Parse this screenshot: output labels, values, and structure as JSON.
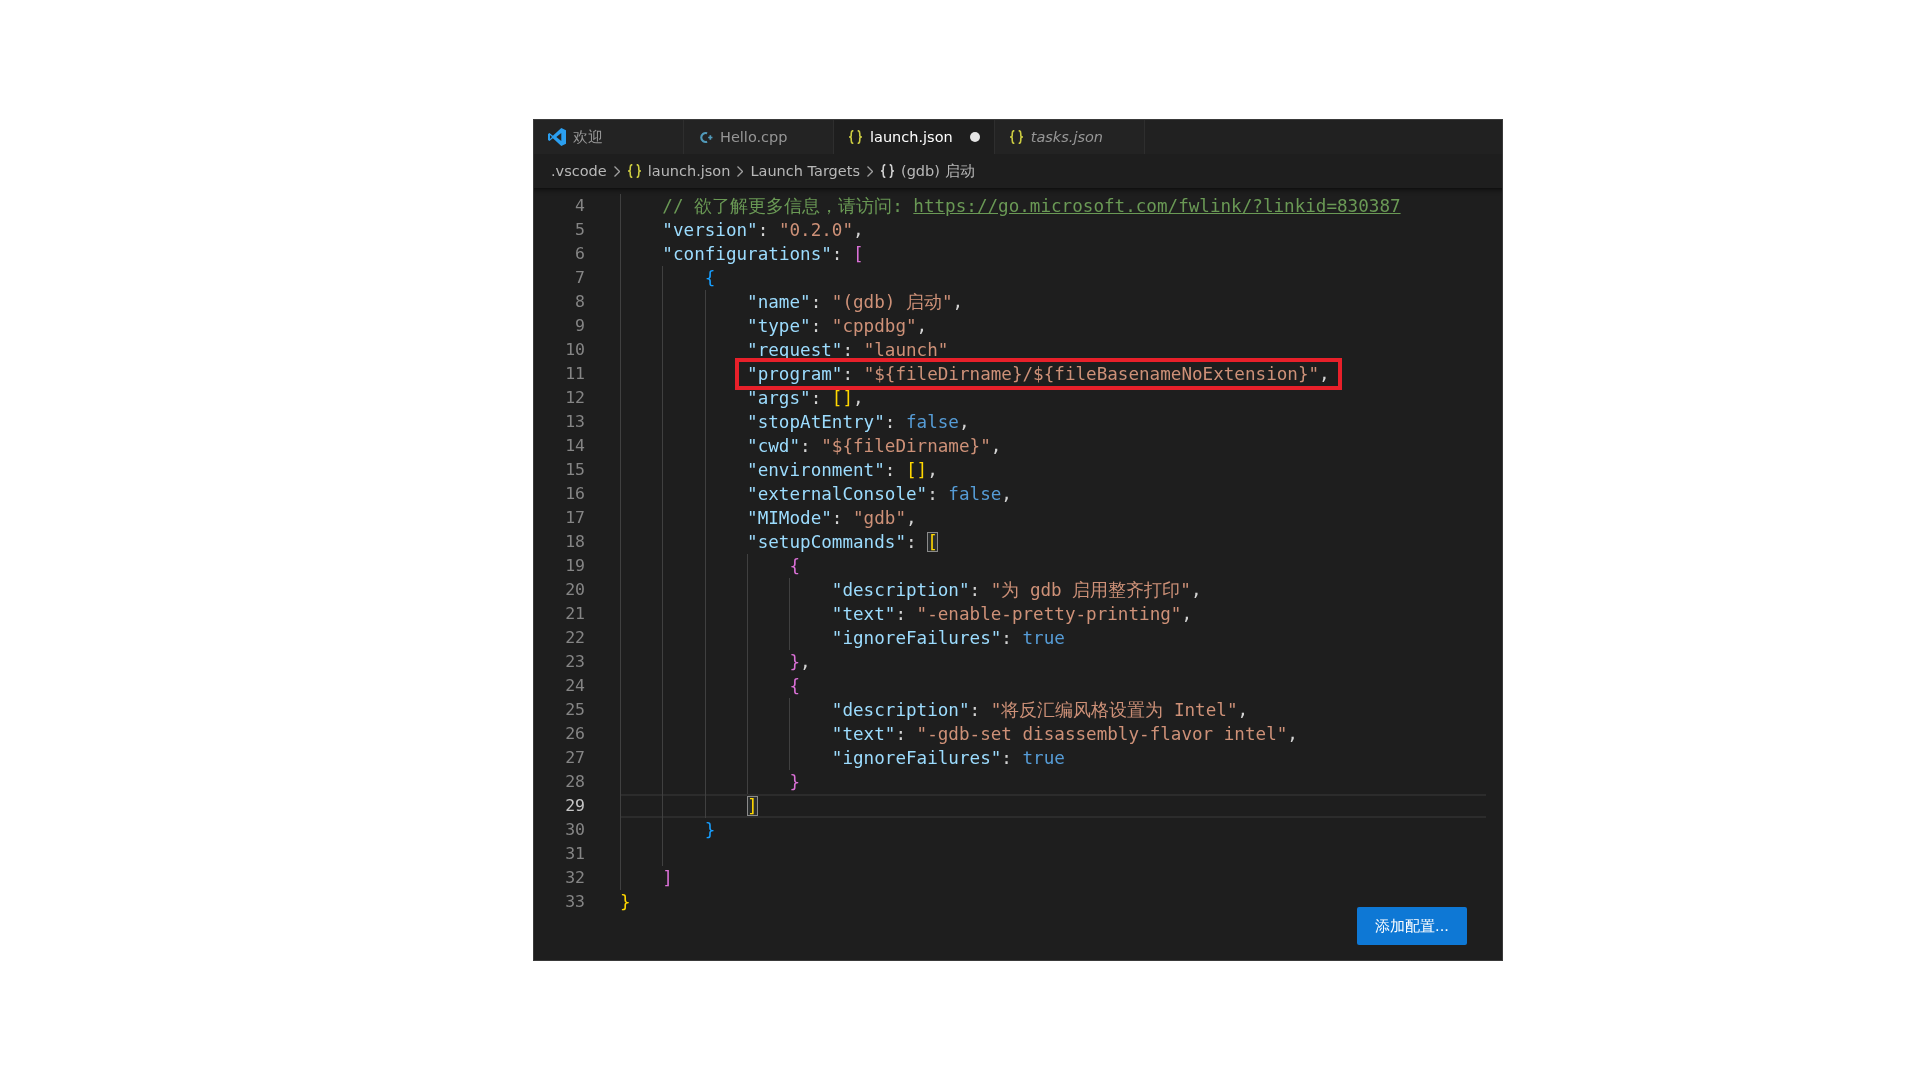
{
  "tabs": [
    {
      "label": "欢迎",
      "kind": "welcome",
      "selected": false,
      "modified": false,
      "preview": false
    },
    {
      "label": "Hello.cpp",
      "kind": "cpp",
      "selected": false,
      "modified": false,
      "preview": false
    },
    {
      "label": "launch.json",
      "kind": "json",
      "selected": true,
      "modified": true,
      "preview": false
    },
    {
      "label": "tasks.json",
      "kind": "json",
      "selected": false,
      "modified": false,
      "preview": true
    }
  ],
  "breadcrumbs": [
    {
      "label": ".vscode",
      "kind": "folder"
    },
    {
      "label": "launch.json",
      "kind": "json"
    },
    {
      "label": "Launch Targets",
      "kind": "section"
    },
    {
      "label": "(gdb) 启动",
      "kind": "object"
    }
  ],
  "editor": {
    "lines": [
      {
        "children": [
          {
            "number": "4",
            "current": false,
            "boxed": false,
            "tokens": [
              {
                "kind": "comment",
                "text": "// 欲了解更多信息，请访问: "
              },
              {
                "kind": "link",
                "text": "https://go.microsoft.com/fwlink/?linkid=830387"
              }
            ]
          },
          {
            "number": "5",
            "current": false,
            "boxed": false,
            "tokens": [
              {
                "kind": "key",
                "text": "\"version\""
              },
              {
                "kind": "punct",
                "text": ": "
              },
              {
                "kind": "string",
                "text": "\"0.2.0\""
              },
              {
                "kind": "punct",
                "text": ","
              }
            ]
          },
          {
            "number": "6",
            "current": false,
            "boxed": false,
            "tokens": [
              {
                "kind": "key",
                "text": "\"configurations\""
              },
              {
                "kind": "punct",
                "text": ": "
              },
              {
                "kind": "bracket",
                "text": "[",
                "color": "#da70d6",
                "matched": false
              }
            ],
            "children": [
              {
                "number": "7",
                "current": false,
                "boxed": false,
                "tokens": [
                  {
                    "kind": "bracket",
                    "text": "{",
                    "color": "#179fff",
                    "matched": false
                  }
                ],
                "children": [
                  {
                    "number": "8",
                    "current": false,
                    "boxed": false,
                    "tokens": [
                      {
                        "kind": "key",
                        "text": "\"name\""
                      },
                      {
                        "kind": "punct",
                        "text": ": "
                      },
                      {
                        "kind": "string",
                        "text": "\"(gdb) 启动\""
                      },
                      {
                        "kind": "punct",
                        "text": ","
                      }
                    ]
                  },
                  {
                    "number": "9",
                    "current": false,
                    "boxed": false,
                    "tokens": [
                      {
                        "kind": "key",
                        "text": "\"type\""
                      },
                      {
                        "kind": "punct",
                        "text": ": "
                      },
                      {
                        "kind": "string",
                        "text": "\"cppdbg\""
                      },
                      {
                        "kind": "punct",
                        "text": ","
                      }
                    ]
                  },
                  {
                    "number": "10",
                    "current": false,
                    "boxed": false,
                    "tokens": [
                      {
                        "kind": "key",
                        "text": "\"request\""
                      },
                      {
                        "kind": "punct",
                        "text": ": "
                      },
                      {
                        "kind": "string",
                        "text": "\"launch\""
                      }
                    ]
                  },
                  {
                    "number": "11",
                    "current": false,
                    "boxed": true,
                    "tokens": [
                      {
                        "kind": "key",
                        "text": "\"program\""
                      },
                      {
                        "kind": "punct",
                        "text": ": "
                      },
                      {
                        "kind": "string",
                        "text": "\"${fileDirname}/${fileBasenameNoExtension}\""
                      },
                      {
                        "kind": "punct",
                        "text": ","
                      }
                    ]
                  },
                  {
                    "number": "12",
                    "current": false,
                    "boxed": false,
                    "tokens": [
                      {
                        "kind": "key",
                        "text": "\"args\""
                      },
                      {
                        "kind": "punct",
                        "text": ": "
                      },
                      {
                        "kind": "bracket",
                        "text": "[]",
                        "color": "#ffd700",
                        "matched": false
                      },
                      {
                        "kind": "punct",
                        "text": ","
                      }
                    ]
                  },
                  {
                    "number": "13",
                    "current": false,
                    "boxed": false,
                    "tokens": [
                      {
                        "kind": "key",
                        "text": "\"stopAtEntry\""
                      },
                      {
                        "kind": "punct",
                        "text": ": "
                      },
                      {
                        "kind": "literal",
                        "text": "false"
                      },
                      {
                        "kind": "punct",
                        "text": ","
                      }
                    ]
                  },
                  {
                    "number": "14",
                    "current": false,
                    "boxed": false,
                    "tokens": [
                      {
                        "kind": "key",
                        "text": "\"cwd\""
                      },
                      {
                        "kind": "punct",
                        "text": ": "
                      },
                      {
                        "kind": "string",
                        "text": "\"${fileDirname}\""
                      },
                      {
                        "kind": "punct",
                        "text": ","
                      }
                    ]
                  },
                  {
                    "number": "15",
                    "current": false,
                    "boxed": false,
                    "tokens": [
                      {
                        "kind": "key",
                        "text": "\"environment\""
                      },
                      {
                        "kind": "punct",
                        "text": ": "
                      },
                      {
                        "kind": "bracket",
                        "text": "[]",
                        "color": "#ffd700",
                        "matched": false
                      },
                      {
                        "kind": "punct",
                        "text": ","
                      }
                    ]
                  },
                  {
                    "number": "16",
                    "current": false,
                    "boxed": false,
                    "tokens": [
                      {
                        "kind": "key",
                        "text": "\"externalConsole\""
                      },
                      {
                        "kind": "punct",
                        "text": ": "
                      },
                      {
                        "kind": "literal",
                        "text": "false"
                      },
                      {
                        "kind": "punct",
                        "text": ","
                      }
                    ]
                  },
                  {
                    "number": "17",
                    "current": false,
                    "boxed": false,
                    "tokens": [
                      {
                        "kind": "key",
                        "text": "\"MIMode\""
                      },
                      {
                        "kind": "punct",
                        "text": ": "
                      },
                      {
                        "kind": "string",
                        "text": "\"gdb\""
                      },
                      {
                        "kind": "punct",
                        "text": ","
                      }
                    ]
                  },
                  {
                    "number": "18",
                    "current": false,
                    "boxed": false,
                    "tokens": [
                      {
                        "kind": "key",
                        "text": "\"setupCommands\""
                      },
                      {
                        "kind": "punct",
                        "text": ": "
                      },
                      {
                        "kind": "bracket",
                        "text": "[",
                        "color": "#ffd700",
                        "matched": true
                      }
                    ],
                    "children": [
                      {
                        "number": "19",
                        "current": false,
                        "boxed": false,
                        "tokens": [
                          {
                            "kind": "bracket",
                            "text": "{",
                            "color": "#da70d6",
                            "matched": false
                          }
                        ],
                        "children": [
                          {
                            "number": "20",
                            "current": false,
                            "boxed": false,
                            "tokens": [
                              {
                                "kind": "key",
                                "text": "\"description\""
                              },
                              {
                                "kind": "punct",
                                "text": ": "
                              },
                              {
                                "kind": "string",
                                "text": "\"为 gdb 启用整齐打印\""
                              },
                              {
                                "kind": "punct",
                                "text": ","
                              }
                            ]
                          },
                          {
                            "number": "21",
                            "current": false,
                            "boxed": false,
                            "tokens": [
                              {
                                "kind": "key",
                                "text": "\"text\""
                              },
                              {
                                "kind": "punct",
                                "text": ": "
                              },
                              {
                                "kind": "string",
                                "text": "\"-enable-pretty-printing\""
                              },
                              {
                                "kind": "punct",
                                "text": ","
                              }
                            ]
                          },
                          {
                            "number": "22",
                            "current": false,
                            "boxed": false,
                            "tokens": [
                              {
                                "kind": "key",
                                "text": "\"ignoreFailures\""
                              },
                              {
                                "kind": "punct",
                                "text": ": "
                              },
                              {
                                "kind": "literal",
                                "text": "true"
                              }
                            ]
                          }
                        ]
                      },
                      {
                        "number": "23",
                        "current": false,
                        "boxed": false,
                        "tokens": [
                          {
                            "kind": "bracket",
                            "text": "}",
                            "color": "#da70d6",
                            "matched": false
                          },
                          {
                            "kind": "punct",
                            "text": ","
                          }
                        ]
                      },
                      {
                        "number": "24",
                        "current": false,
                        "boxed": false,
                        "tokens": [
                          {
                            "kind": "bracket",
                            "text": "{",
                            "color": "#da70d6",
                            "matched": false
                          }
                        ],
                        "children": [
                          {
                            "number": "25",
                            "current": false,
                            "boxed": false,
                            "tokens": [
                              {
                                "kind": "key",
                                "text": "\"description\""
                              },
                              {
                                "kind": "punct",
                                "text": ": "
                              },
                              {
                                "kind": "string",
                                "text": "\"将反汇编风格设置为 Intel\""
                              },
                              {
                                "kind": "punct",
                                "text": ","
                              }
                            ]
                          },
                          {
                            "number": "26",
                            "current": false,
                            "boxed": false,
                            "tokens": [
                              {
                                "kind": "key",
                                "text": "\"text\""
                              },
                              {
                                "kind": "punct",
                                "text": ": "
                              },
                              {
                                "kind": "string",
                                "text": "\"-gdb-set disassembly-flavor intel\""
                              },
                              {
                                "kind": "punct",
                                "text": ","
                              }
                            ]
                          },
                          {
                            "number": "27",
                            "current": false,
                            "boxed": false,
                            "tokens": [
                              {
                                "kind": "key",
                                "text": "\"ignoreFailures\""
                              },
                              {
                                "kind": "punct",
                                "text": ": "
                              },
                              {
                                "kind": "literal",
                                "text": "true"
                              }
                            ]
                          }
                        ]
                      },
                      {
                        "number": "28",
                        "current": false,
                        "boxed": false,
                        "tokens": [
                          {
                            "kind": "bracket",
                            "text": "}",
                            "color": "#da70d6",
                            "matched": false
                          }
                        ]
                      }
                    ]
                  },
                  {
                    "number": "29",
                    "current": true,
                    "boxed": false,
                    "tokens": [
                      {
                        "kind": "bracket",
                        "text": "]",
                        "color": "#ffd700",
                        "matched": true
                      }
                    ]
                  }
                ]
              },
              {
                "number": "30",
                "current": false,
                "boxed": false,
                "tokens": [
                  {
                    "kind": "bracket",
                    "text": "}",
                    "color": "#179fff",
                    "matched": false
                  }
                ]
              },
              {
                "number": "31",
                "current": false,
                "boxed": false
              }
            ]
          },
          {
            "number": "32",
            "current": false,
            "boxed": false,
            "tokens": [
              {
                "kind": "bracket",
                "text": "]",
                "color": "#da70d6",
                "matched": false
              }
            ]
          }
        ]
      },
      {
        "number": "33",
        "current": false,
        "boxed": false,
        "tokens": [
          {
            "kind": "bracket",
            "text": "}",
            "color": "#ffd700",
            "matched": false
          }
        ]
      }
    ]
  },
  "add_configuration_button": {
    "label": "添加配置..."
  }
}
